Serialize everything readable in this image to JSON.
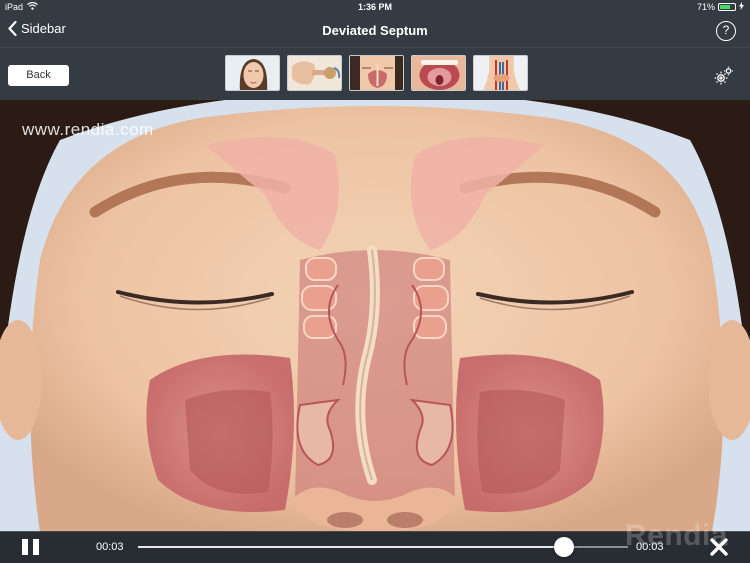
{
  "status_bar": {
    "device": "iPad",
    "time": "1:36 PM",
    "battery_percent_text": "71%",
    "battery_level": 0.71,
    "icons": [
      "wifi-icon",
      "battery-icon",
      "charging-icon"
    ]
  },
  "nav": {
    "back_label": "Sidebar",
    "title": "Deviated Septum",
    "help_label": "?"
  },
  "toolbar": {
    "back_button": "Back",
    "thumbnails": [
      {
        "name": "thumb-face",
        "subject": "face"
      },
      {
        "name": "thumb-ear-anatomy",
        "subject": "ear anatomy"
      },
      {
        "name": "thumb-nasal-anatomy",
        "subject": "nasal anatomy"
      },
      {
        "name": "thumb-mouth-throat",
        "subject": "mouth / throat"
      },
      {
        "name": "thumb-neck-anatomy",
        "subject": "neck anatomy"
      }
    ],
    "settings_icon": "gear-icon"
  },
  "stage": {
    "watermark": "www.rendia.com",
    "logo_text": "Rendia"
  },
  "player": {
    "elapsed": "00:03",
    "duration": "00:03",
    "progress": 0.87,
    "pause_icon": "pause-icon",
    "close_icon": "close-icon"
  },
  "colors": {
    "chrome": "#353b42",
    "skin": "#efc9ac",
    "sinus": "#c96a6c",
    "battery_fill": "#4cd964"
  }
}
